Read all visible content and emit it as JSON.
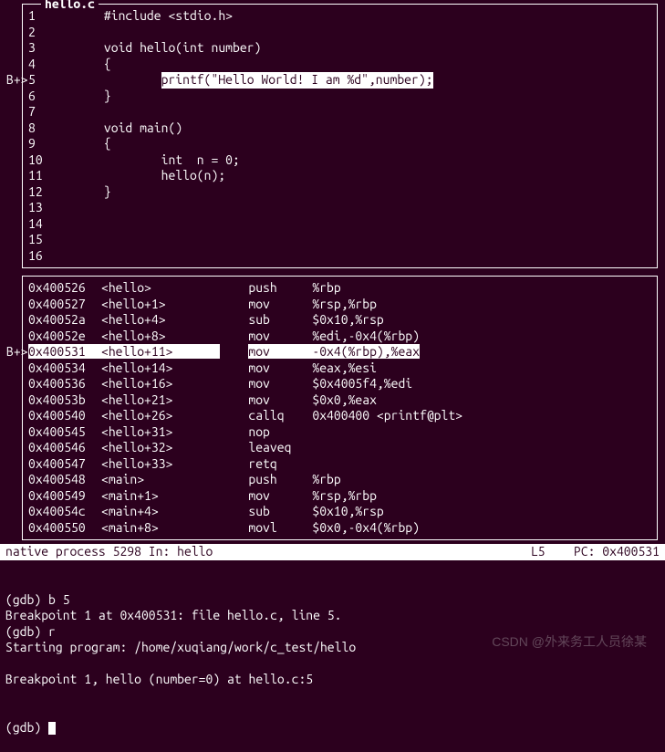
{
  "source": {
    "filename": "hello.c",
    "breakpoint_marker": "B+>",
    "lines": [
      {
        "n": "1",
        "indent": "       ",
        "text": "#include <stdio.h>",
        "bp": false,
        "hl": false
      },
      {
        "n": "2",
        "indent": "",
        "text": "",
        "bp": false,
        "hl": false
      },
      {
        "n": "3",
        "indent": "       ",
        "text": "void hello(int number)",
        "bp": false,
        "hl": false
      },
      {
        "n": "4",
        "indent": "       ",
        "text": "{",
        "bp": false,
        "hl": false
      },
      {
        "n": "5",
        "indent": "               ",
        "text": "printf(\"Hello World! I am %d\",number);",
        "bp": true,
        "hl": true
      },
      {
        "n": "6",
        "indent": "       ",
        "text": "}",
        "bp": false,
        "hl": false
      },
      {
        "n": "7",
        "indent": "",
        "text": "",
        "bp": false,
        "hl": false
      },
      {
        "n": "8",
        "indent": "       ",
        "text": "void main()",
        "bp": false,
        "hl": false
      },
      {
        "n": "9",
        "indent": "       ",
        "text": "{",
        "bp": false,
        "hl": false
      },
      {
        "n": "10",
        "indent": "               ",
        "text": "int  n = 0;",
        "bp": false,
        "hl": false
      },
      {
        "n": "11",
        "indent": "               ",
        "text": "hello(n);",
        "bp": false,
        "hl": false
      },
      {
        "n": "12",
        "indent": "       ",
        "text": "}",
        "bp": false,
        "hl": false
      },
      {
        "n": "13",
        "indent": "",
        "text": "",
        "bp": false,
        "hl": false
      },
      {
        "n": "14",
        "indent": "",
        "text": "",
        "bp": false,
        "hl": false
      },
      {
        "n": "15",
        "indent": "",
        "text": "",
        "bp": false,
        "hl": false
      },
      {
        "n": "16",
        "indent": "",
        "text": "",
        "bp": false,
        "hl": false
      }
    ]
  },
  "asm": {
    "breakpoint_marker": "B+>",
    "rows": [
      {
        "addr": "0x400526",
        "sym": "<hello>",
        "op": "push",
        "args": "%rbp",
        "bp": false,
        "hl": false
      },
      {
        "addr": "0x400527",
        "sym": "<hello+1>",
        "op": "mov",
        "args": "%rsp,%rbp",
        "bp": false,
        "hl": false
      },
      {
        "addr": "0x40052a",
        "sym": "<hello+4>",
        "op": "sub",
        "args": "$0x10,%rsp",
        "bp": false,
        "hl": false
      },
      {
        "addr": "0x40052e",
        "sym": "<hello+8>",
        "op": "mov",
        "args": "%edi,-0x4(%rbp)",
        "bp": false,
        "hl": false
      },
      {
        "addr": "0x400531",
        "sym": "<hello+11>",
        "op": "mov",
        "args": "-0x4(%rbp),%eax",
        "bp": true,
        "hl": true
      },
      {
        "addr": "0x400534",
        "sym": "<hello+14>",
        "op": "mov",
        "args": "%eax,%esi",
        "bp": false,
        "hl": false
      },
      {
        "addr": "0x400536",
        "sym": "<hello+16>",
        "op": "mov",
        "args": "$0x4005f4,%edi",
        "bp": false,
        "hl": false
      },
      {
        "addr": "0x40053b",
        "sym": "<hello+21>",
        "op": "mov",
        "args": "$0x0,%eax",
        "bp": false,
        "hl": false
      },
      {
        "addr": "0x400540",
        "sym": "<hello+26>",
        "op": "callq",
        "args": "0x400400 <printf@plt>",
        "bp": false,
        "hl": false
      },
      {
        "addr": "0x400545",
        "sym": "<hello+31>",
        "op": "nop",
        "args": "",
        "bp": false,
        "hl": false
      },
      {
        "addr": "0x400546",
        "sym": "<hello+32>",
        "op": "leaveq",
        "args": "",
        "bp": false,
        "hl": false
      },
      {
        "addr": "0x400547",
        "sym": "<hello+33>",
        "op": "retq",
        "args": "",
        "bp": false,
        "hl": false
      },
      {
        "addr": "0x400548",
        "sym": "<main>",
        "op": "push",
        "args": "%rbp",
        "bp": false,
        "hl": false
      },
      {
        "addr": "0x400549",
        "sym": "<main+1>",
        "op": "mov",
        "args": "%rsp,%rbp",
        "bp": false,
        "hl": false
      },
      {
        "addr": "0x40054c",
        "sym": "<main+4>",
        "op": "sub",
        "args": "$0x10,%rsp",
        "bp": false,
        "hl": false
      },
      {
        "addr": "0x400550",
        "sym": "<main+8>",
        "op": "movl",
        "args": "$0x0,-0x4(%rbp)",
        "bp": false,
        "hl": false
      }
    ]
  },
  "status": {
    "left": "native process 5298 In: hello",
    "line_label": "L5",
    "pc_label": "PC: 0x400531"
  },
  "cmd": {
    "lines": [
      "(gdb) b 5",
      "Breakpoint 1 at 0x400531: file hello.c, line 5.",
      "(gdb) r",
      "Starting program: /home/xuqiang/work/c_test/hello",
      "",
      "Breakpoint 1, hello (number=0) at hello.c:5"
    ],
    "prompt": "(gdb) "
  },
  "watermark": "CSDN @外来务工人员徐某"
}
